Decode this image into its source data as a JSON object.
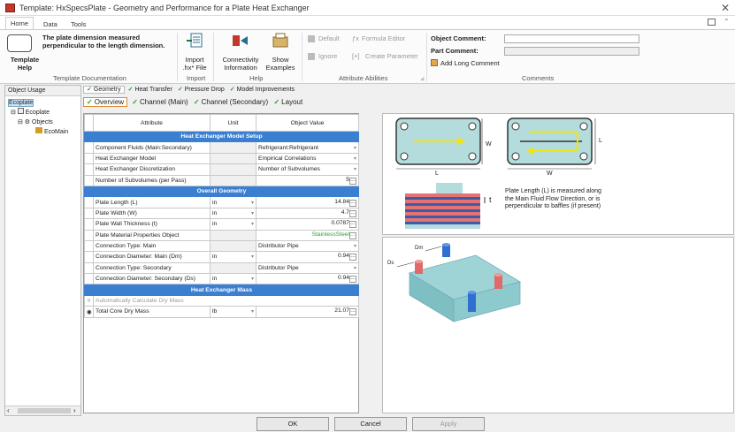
{
  "window": {
    "title": "Template: HxSpecsPlate - Geometry and Performance for a Plate Heat Exchanger"
  },
  "menu_tabs": [
    "Home",
    "Data",
    "Tools"
  ],
  "ribbon": {
    "template_help": {
      "description": "The plate dimension measured perpendicular to the length dimension.",
      "label": "Template Help",
      "group": "Template Documentation"
    },
    "import": {
      "label": "Import .hx* File",
      "group": "Import"
    },
    "connectivity": {
      "label": "Connectivity Information"
    },
    "show_examples": {
      "label": "Show Examples"
    },
    "help_group": "Help",
    "attribute": {
      "default": "Default",
      "formula_editor": "Formula Editor",
      "ignore": "Ignore",
      "create_parameter": "Create Parameter",
      "group": "Attribute Abilities"
    },
    "comments": {
      "object_comment": "Object Comment:",
      "part_comment": "Part Comment:",
      "add_long_comment": "Add Long Comment",
      "group": "Comments"
    }
  },
  "left_panel": {
    "header": "Object Usage",
    "tree": [
      "Ecoplate",
      "Ecoplate",
      "Objects",
      "EcoMain"
    ]
  },
  "subtabs": [
    "Geometry",
    "Heat Transfer",
    "Pressure Drop",
    "Model Improvements"
  ],
  "subtabs2": [
    "Overview",
    "Channel (Main)",
    "Channel (Secondary)",
    "Layout"
  ],
  "grid": {
    "headers": [
      "Attribute",
      "Unit",
      "Object Value"
    ],
    "sections": {
      "s1": "Heat Exchanger Model Setup",
      "s2": "Overall Geometry",
      "s3": "Heat Exchanger Mass"
    },
    "rows": {
      "r1": {
        "attr": "Component Fluids (Main:Secondary)",
        "unit": "",
        "value": "Refrigerant:Refrigerant"
      },
      "r2": {
        "attr": "Heat Exchanger Model",
        "unit": "",
        "value": "Empirical Correlations"
      },
      "r3": {
        "attr": "Heat Exchanger Discretization",
        "unit": "",
        "value": "Number of Subvolumes"
      },
      "r4": {
        "attr": "Number of Subvolumes (per Pass)",
        "unit": "",
        "value": "5"
      },
      "r5": {
        "attr": "Plate Length (L)",
        "unit": "in",
        "value": "14.84"
      },
      "r6": {
        "attr": "Plate Width (W)",
        "unit": "in",
        "value": "4.7"
      },
      "r7": {
        "attr": "Plate Wall Thickness (t)",
        "unit": "in",
        "value": "0.0787"
      },
      "r8": {
        "attr": "Plate Material Properties Object",
        "unit": "",
        "value": "StainlessSteel"
      },
      "r9": {
        "attr": "Connection Type: Main",
        "unit": "",
        "value": "Distributor Pipe"
      },
      "r10": {
        "attr": "Connection Diameter: Main (Dm)",
        "unit": "in",
        "value": "0.94"
      },
      "r11": {
        "attr": "Connection Type: Secondary",
        "unit": "",
        "value": "Distributor Pipe"
      },
      "r12": {
        "attr": "Connection Diameter: Secondary (Ds)",
        "unit": "in",
        "value": "0.94"
      },
      "r13": {
        "attr": "Automatically Calculate Dry Mass",
        "unit": "",
        "value": ""
      },
      "r14": {
        "attr": "Total Core Dry Mass",
        "unit": "lb",
        "value": "21.07"
      }
    }
  },
  "diagram": {
    "note": "Plate Length (L) is measured along the Main Fluid Flow Direction, or is perpendicular to baffles (if present)",
    "labels": {
      "w": "W",
      "l": "L",
      "t": "t",
      "ds": "Ds",
      "dm": "Dm"
    }
  },
  "buttons": {
    "ok": "OK",
    "cancel": "Cancel",
    "apply": "Apply"
  },
  "colors": {
    "section_header": "#3b7fd1",
    "plate_fill": "#b4dcdc",
    "stainless": "#2ea22e"
  }
}
